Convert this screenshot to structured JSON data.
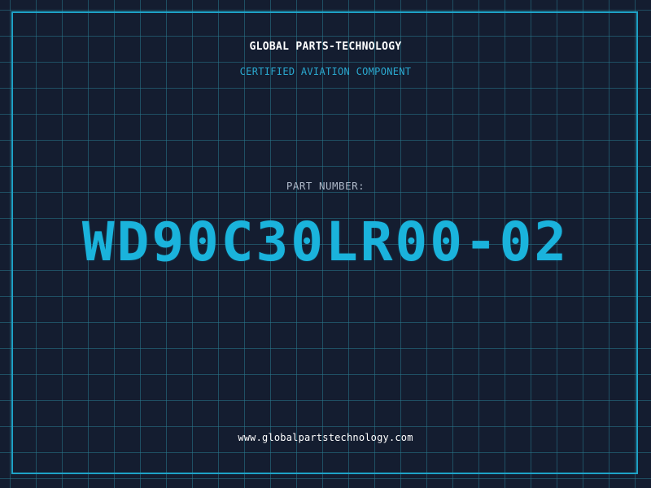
{
  "header": {
    "company": "GLOBAL PARTS-TECHNOLOGY",
    "tagline": "CERTIFIED AVIATION COMPONENT"
  },
  "part": {
    "label": "PART NUMBER:",
    "number": "WD90C30LR00-02"
  },
  "footer": {
    "website": "www.globalpartstechnology.com"
  },
  "colors": {
    "background": "#141d30",
    "accent": "#1ab3dc",
    "grid": "#28788c"
  }
}
